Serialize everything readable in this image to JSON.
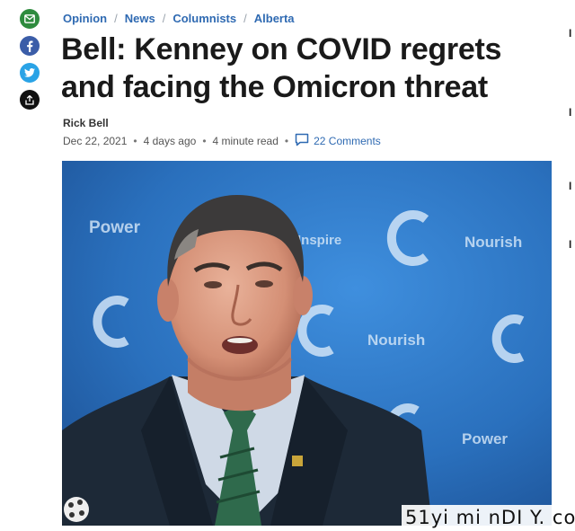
{
  "share": {
    "email_icon": "email-icon",
    "facebook_icon": "facebook-icon",
    "twitter_icon": "twitter-icon",
    "more_icon": "share-more-icon",
    "colors": {
      "email": "#2e8b3e",
      "facebook": "#3b5da8",
      "twitter": "#2aa3e6",
      "more": "#111111"
    }
  },
  "breadcrumb": {
    "items": [
      "Opinion",
      "News",
      "Columnists",
      "Alberta"
    ],
    "separator": "/"
  },
  "article": {
    "title_line1": "Bell: Kenney on COVID regrets",
    "title_line2": "and facing the Omicron threat",
    "author": "Rick Bell",
    "date": "Dec 22, 2021",
    "relative_time": "4 days ago",
    "read_time": "4 minute read",
    "comments_label": "22 Comments",
    "comments_icon": "comment-icon",
    "meta_separator": "•"
  },
  "photo": {
    "backdrop_words": [
      "Power",
      "Inspire",
      "Nourish",
      "Nourish",
      "Power"
    ],
    "backdrop_letter": "C"
  },
  "right_edge": [
    "I",
    "I",
    "I",
    "I"
  ],
  "watermark": "51yi mi nDI Y. co",
  "accent_color": "#2f6ab2"
}
